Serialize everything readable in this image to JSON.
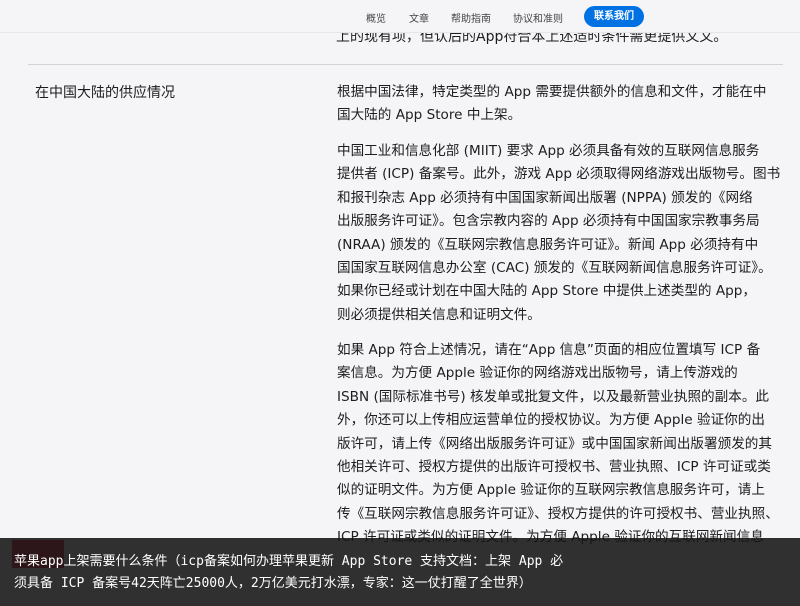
{
  "nav": {
    "links": [
      "概览",
      "文章",
      "帮助指南",
      "协议和准则"
    ],
    "cta": "联系我们"
  },
  "cut_top_text": "上的现有项，但认后的App符合本上述适时条件需更提供文文。",
  "section": {
    "label": "在中国大陆的供应情况",
    "paragraphs": [
      [
        "根据中国法律，特定类型的 App 需要提供额外的信息和文件，才能在中",
        "国大陆的 App Store 中上架。"
      ],
      [
        "中国工业和信息化部 (MIIT) 要求 App 必须具备有效的互联网信息服务",
        "提供者 (ICP) 备案号。此外，游戏 App 必须取得网络游戏出版物号。图书",
        "和报刊杂志 App 必须持有中国国家新闻出版署 (NPPA) 颁发的《网络",
        "出版服务许可证》。包含宗教内容的 App 必须持有中国国家宗教事务局",
        "(NRAA) 颁发的《互联网宗教信息服务许可证》。新闻 App 必须持有中",
        "国国家互联网信息办公室 (CAC) 颁发的《互联网新闻信息服务许可证》。",
        "如果你已经或计划在中国大陆的 App Store 中提供上述类型的 App，",
        "则必须提供相关信息和证明文件。"
      ],
      [
        "如果 App 符合上述情况，请在“App 信息”页面的相应位置填写 ICP 备",
        "案信息。为方便 Apple 验证你的网络游戏出版物号，请上传游戏的",
        "ISBN (国际标准书号) 核发单或批复文件，以及最新营业执照的副本。此",
        "外，你还可以上传相应运营单位的授权协议。为方便 Apple 验证你的出",
        "版许可，请上传《网络出版服务许可证》或中国国家新闻出版署颁发的其",
        "他相关许可、授权方提供的出版许可授权书、营业执照、ICP 许可证或类",
        "似的证明文件。为方便 Apple 验证你的互联网宗教信息服务许可，请上",
        "传《互联网宗教信息服务许可证》、授权方提供的许可授权书、营业执照、",
        "ICP 许可证或类似的证明文件。为方便 Apple 验证你的互联网新闻信息"
      ]
    ]
  },
  "caption": {
    "lines": [
      "苹果app上架需要什么条件（icp备案如何办理苹果更新 App Store 支持文档：上架 App 必",
      "须具备 ICP 备案号42天阵亡25000人，2万亿美元打水漂，专家：这一仗打醒了全世界）"
    ]
  },
  "colors": {
    "accent": "#0071e3",
    "background": "#f5f5f7",
    "caption_bg": "#141414"
  }
}
